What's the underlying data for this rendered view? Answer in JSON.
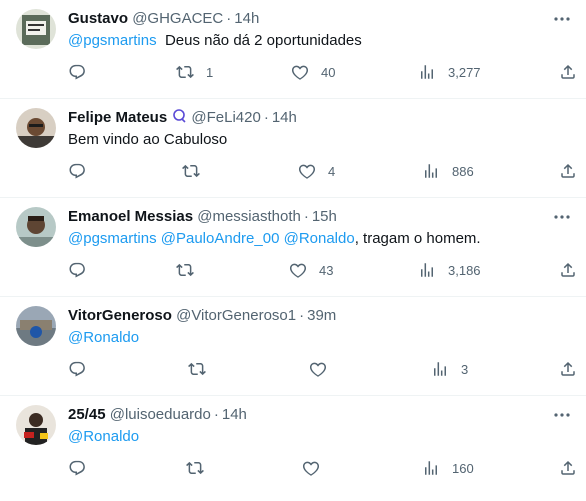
{
  "tweets": [
    {
      "name": "Gustavo",
      "handle": "@GHGACEC",
      "time": "14h",
      "mentions": [
        "@pgsmartins"
      ],
      "text": "Deus não dá 2 oportunidades",
      "counts": {
        "reply": "",
        "retweet": "1",
        "like": "40",
        "views": "3,277"
      },
      "avatar_colors": [
        "#5b6b5a",
        "#dfe3d8"
      ]
    },
    {
      "name": "Felipe Mateus",
      "handle": "@FeLi420",
      "time": "14h",
      "mentions": [],
      "text": "Bem vindo ao Cabuloso",
      "counts": {
        "reply": "",
        "retweet": "",
        "like": "4",
        "views": "886"
      },
      "avatar_colors": [
        "#d8cfc3",
        "#6b4a33"
      ]
    },
    {
      "name": "Emanoel Messias",
      "handle": "@messiasthoth",
      "time": "15h",
      "mentions": [
        "@pgsmartins",
        "@PauloAndre_00",
        "@Ronaldo"
      ],
      "text": ", tragam o homem.",
      "counts": {
        "reply": "",
        "retweet": "",
        "like": "43",
        "views": "3,186"
      },
      "avatar_colors": [
        "#b7c9c6",
        "#5e4533"
      ]
    },
    {
      "name": "VitorGeneroso",
      "handle": "@VitorGeneroso1",
      "time": "39m",
      "mentions": [
        "@Ronaldo"
      ],
      "text": "",
      "counts": {
        "reply": "",
        "retweet": "",
        "like": "",
        "views": "3"
      },
      "avatar_colors": [
        "#9aa7b5",
        "#1f56a8"
      ]
    },
    {
      "name": "25/45",
      "handle": "@luisoeduardo",
      "time": "14h",
      "mentions": [
        "@Ronaldo"
      ],
      "text": "",
      "counts": {
        "reply": "",
        "retweet": "",
        "like": "",
        "views": "160"
      },
      "avatar_colors": [
        "#e9e4dc",
        "#c5221f"
      ]
    }
  ],
  "icons": {
    "reply": "reply-icon",
    "retweet": "retweet-icon",
    "like": "like-icon",
    "views": "views-icon",
    "share": "share-icon",
    "more": "more-icon"
  },
  "colors": {
    "text": "#0f1419",
    "muted": "#536471",
    "link": "#1d9bf0",
    "divider": "#eff3f4"
  }
}
